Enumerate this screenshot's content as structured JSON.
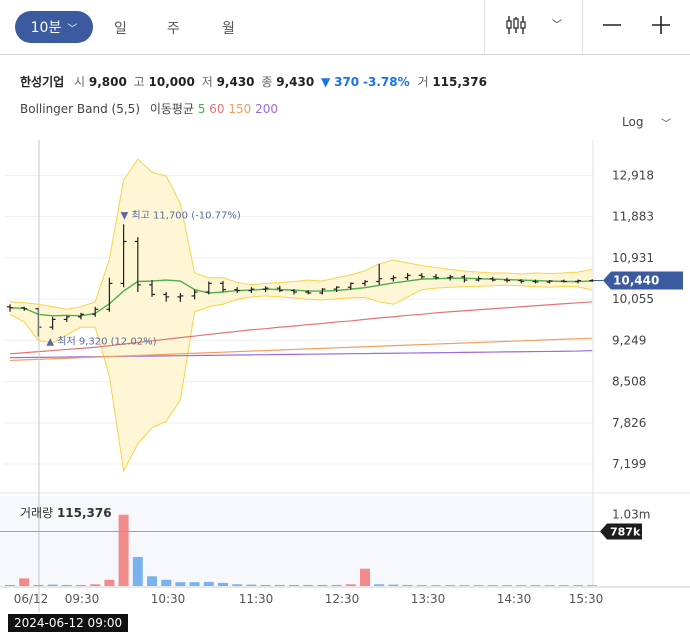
{
  "toolbar": {
    "timeframe": "10분",
    "tabs": [
      "일",
      "주",
      "월"
    ]
  },
  "quote": {
    "name": "한성기업",
    "open_label": "시",
    "open": "9,800",
    "high_label": "고",
    "high": "10,000",
    "low_label": "저",
    "low": "9,430",
    "close_label": "종",
    "close": "9,430",
    "change_arrow": "▼",
    "change": "370",
    "change_pct": "-3.78%",
    "volume_label": "거",
    "volume": "115,376"
  },
  "indicators": {
    "bb_label": "Bollinger Band (5,5)",
    "ma_label": "이동평균",
    "ma_periods": [
      "5",
      "60",
      "150",
      "200"
    ]
  },
  "colors": {
    "ma5": "#4caf50",
    "ma60": "#e57373",
    "ma150": "#f0a060",
    "ma200": "#9c6ade",
    "bb_line": "#f7d34a",
    "bb_fill": "#fff6d5",
    "up": "#f28b8b",
    "down": "#7ab2f0",
    "accent": "#3b5aa0",
    "price_tag": "#3b5aa0"
  },
  "scale_label": "Log",
  "volume_panel": {
    "label": "거래량",
    "value": "115,376",
    "tick": "1.03m",
    "current_tag": "787k"
  },
  "crosshair_date": "2024-06-12 09:00",
  "chart_data": {
    "type": "candlestick",
    "scale": "log",
    "ylim": [
      6900,
      13600
    ],
    "price_ticks": [
      "12,918",
      "11,883",
      "10,931",
      "10,055",
      "9,249",
      "8,508",
      "7,826",
      "7,199"
    ],
    "price_tick_values": [
      12918,
      11883,
      10931,
      10055,
      9249,
      8508,
      7826,
      7199
    ],
    "current_price": "10,440",
    "current_price_value": 10440,
    "x_ticks": [
      "06/12",
      "09:30",
      "10:30",
      "11:30",
      "12:30",
      "13:30",
      "14:30",
      "15:30"
    ],
    "x_tick_index": [
      0,
      5,
      11,
      17,
      23,
      29,
      35,
      41
    ],
    "high_annotation": "▼ 최고 11,700 (-10.77%)",
    "low_annotation": "▲ 최저 9,320 (12.02%)",
    "candles": [
      [
        9900,
        9950,
        9800,
        9880
      ],
      [
        9880,
        9900,
        9820,
        9860
      ],
      [
        9860,
        9880,
        9320,
        9500
      ],
      [
        9500,
        9700,
        9450,
        9650
      ],
      [
        9650,
        9720,
        9600,
        9700
      ],
      [
        9700,
        9780,
        9650,
        9750
      ],
      [
        9750,
        9900,
        9700,
        9850
      ],
      [
        9850,
        10500,
        9800,
        10380
      ],
      [
        10380,
        11700,
        10300,
        11300
      ],
      [
        11300,
        11400,
        10200,
        10350
      ],
      [
        10350,
        10450,
        10100,
        10150
      ],
      [
        10150,
        10200,
        10000,
        10100
      ],
      [
        10100,
        10180,
        10000,
        10120
      ],
      [
        10120,
        10250,
        10050,
        10200
      ],
      [
        10200,
        10420,
        10150,
        10380
      ],
      [
        10380,
        10430,
        10200,
        10250
      ],
      [
        10250,
        10300,
        10180,
        10230
      ],
      [
        10230,
        10300,
        10180,
        10260
      ],
      [
        10260,
        10320,
        10200,
        10280
      ],
      [
        10280,
        10330,
        10200,
        10230
      ],
      [
        10230,
        10260,
        10150,
        10200
      ],
      [
        10200,
        10240,
        10150,
        10180
      ],
      [
        10180,
        10280,
        10150,
        10260
      ],
      [
        10260,
        10320,
        10200,
        10300
      ],
      [
        10300,
        10400,
        10250,
        10380
      ],
      [
        10380,
        10450,
        10320,
        10420
      ],
      [
        10420,
        10800,
        10350,
        10480
      ],
      [
        10480,
        10550,
        10420,
        10500
      ],
      [
        10500,
        10600,
        10450,
        10550
      ],
      [
        10550,
        10600,
        10480,
        10520
      ],
      [
        10520,
        10580,
        10460,
        10500
      ],
      [
        10500,
        10560,
        10440,
        10520
      ],
      [
        10520,
        10560,
        10400,
        10450
      ],
      [
        10450,
        10530,
        10420,
        10480
      ],
      [
        10480,
        10520,
        10420,
        10450
      ],
      [
        10450,
        10500,
        10400,
        10440
      ],
      [
        10440,
        10470,
        10380,
        10420
      ],
      [
        10420,
        10460,
        10380,
        10410
      ],
      [
        10410,
        10450,
        10380,
        10430
      ],
      [
        10430,
        10460,
        10400,
        10420
      ],
      [
        10420,
        10460,
        10380,
        10440
      ],
      [
        10440,
        10470,
        10410,
        10440
      ]
    ],
    "bb_upper": [
      10000,
      9980,
      9950,
      9900,
      9850,
      9900,
      10000,
      10900,
      12800,
      13350,
      13000,
      12900,
      12200,
      10600,
      10500,
      10500,
      10400,
      10350,
      10380,
      10400,
      10420,
      10450,
      10430,
      10500,
      10560,
      10650,
      10800,
      10880,
      10820,
      10760,
      10720,
      10680,
      10640,
      10620,
      10600,
      10600,
      10580,
      10600,
      10590,
      10600,
      10620,
      10680
    ],
    "bb_lower": [
      9750,
      9600,
      9250,
      9200,
      9350,
      9500,
      9500,
      8600,
      7100,
      7500,
      7750,
      7850,
      8200,
      9800,
      9900,
      9950,
      10050,
      10100,
      10120,
      10100,
      10080,
      10050,
      10040,
      10060,
      10080,
      10090,
      10000,
      9950,
      10100,
      10250,
      10280,
      10300,
      10310,
      10320,
      10330,
      10340,
      10330,
      10310,
      10300,
      10320,
      10310,
      10240
    ],
    "ma5": [
      9880,
      9870,
      9750,
      9720,
      9730,
      9720,
      9770,
      9960,
      10220,
      10420,
      10430,
      10450,
      10430,
      10250,
      10180,
      10200,
      10230,
      10240,
      10260,
      10250,
      10240,
      10220,
      10220,
      10230,
      10260,
      10290,
      10340,
      10390,
      10430,
      10470,
      10480,
      10490,
      10490,
      10480,
      10470,
      10460,
      10450,
      10440,
      10430,
      10420,
      10420,
      10430
    ],
    "ma60": [
      9000,
      9020,
      9040,
      9060,
      9080,
      9100,
      9120,
      9150,
      9180,
      9210,
      9240,
      9270,
      9300,
      9330,
      9360,
      9390,
      9420,
      9450,
      9470,
      9500,
      9520,
      9550,
      9570,
      9600,
      9620,
      9650,
      9680,
      9700,
      9730,
      9750,
      9780,
      9800,
      9820,
      9840,
      9860,
      9880,
      9900,
      9920,
      9940,
      9960,
      9980,
      10000
    ],
    "ma150": [
      8880,
      8890,
      8900,
      8910,
      8920,
      8930,
      8940,
      8950,
      8960,
      8970,
      8980,
      8990,
      9000,
      9010,
      9020,
      9030,
      9040,
      9050,
      9060,
      9070,
      9080,
      9090,
      9100,
      9110,
      9120,
      9130,
      9140,
      9150,
      9160,
      9170,
      9180,
      9190,
      9200,
      9210,
      9220,
      9230,
      9240,
      9250,
      9260,
      9270,
      9280,
      9290
    ],
    "ma200": [
      8930,
      8933,
      8936,
      8939,
      8942,
      8945,
      8948,
      8951,
      8954,
      8957,
      8960,
      8963,
      8966,
      8969,
      8972,
      8975,
      8978,
      8981,
      8984,
      8987,
      8990,
      8993,
      8996,
      8999,
      9002,
      9005,
      9008,
      9011,
      9014,
      9017,
      9020,
      9023,
      9026,
      9029,
      9032,
      9035,
      9038,
      9041,
      9044,
      9047,
      9050,
      9060
    ],
    "volume_ylim": [
      0,
      1300000
    ],
    "volume_tick_value": 1030000,
    "volume_current_value": 787000,
    "volumes": [
      [
        15000,
        "d"
      ],
      [
        110000,
        "u"
      ],
      [
        15000,
        "d"
      ],
      [
        20000,
        "d"
      ],
      [
        15000,
        "d"
      ],
      [
        15000,
        "d"
      ],
      [
        25000,
        "u"
      ],
      [
        90000,
        "u"
      ],
      [
        1030000,
        "u"
      ],
      [
        420000,
        "d"
      ],
      [
        140000,
        "d"
      ],
      [
        90000,
        "d"
      ],
      [
        55000,
        "d"
      ],
      [
        55000,
        "d"
      ],
      [
        60000,
        "d"
      ],
      [
        45000,
        "d"
      ],
      [
        25000,
        "d"
      ],
      [
        20000,
        "d"
      ],
      [
        15000,
        "d"
      ],
      [
        15000,
        "d"
      ],
      [
        15000,
        "d"
      ],
      [
        15000,
        "d"
      ],
      [
        15000,
        "d"
      ],
      [
        15000,
        "d"
      ],
      [
        25000,
        "u"
      ],
      [
        250000,
        "u"
      ],
      [
        25000,
        "d"
      ],
      [
        20000,
        "d"
      ],
      [
        15000,
        "d"
      ],
      [
        12000,
        "d"
      ],
      [
        12000,
        "d"
      ],
      [
        12000,
        "d"
      ],
      [
        12000,
        "d"
      ],
      [
        12000,
        "d"
      ],
      [
        12000,
        "d"
      ],
      [
        12000,
        "d"
      ],
      [
        12000,
        "d"
      ],
      [
        12000,
        "d"
      ],
      [
        12000,
        "d"
      ],
      [
        12000,
        "d"
      ],
      [
        12000,
        "d"
      ],
      [
        12000,
        "d"
      ]
    ]
  }
}
